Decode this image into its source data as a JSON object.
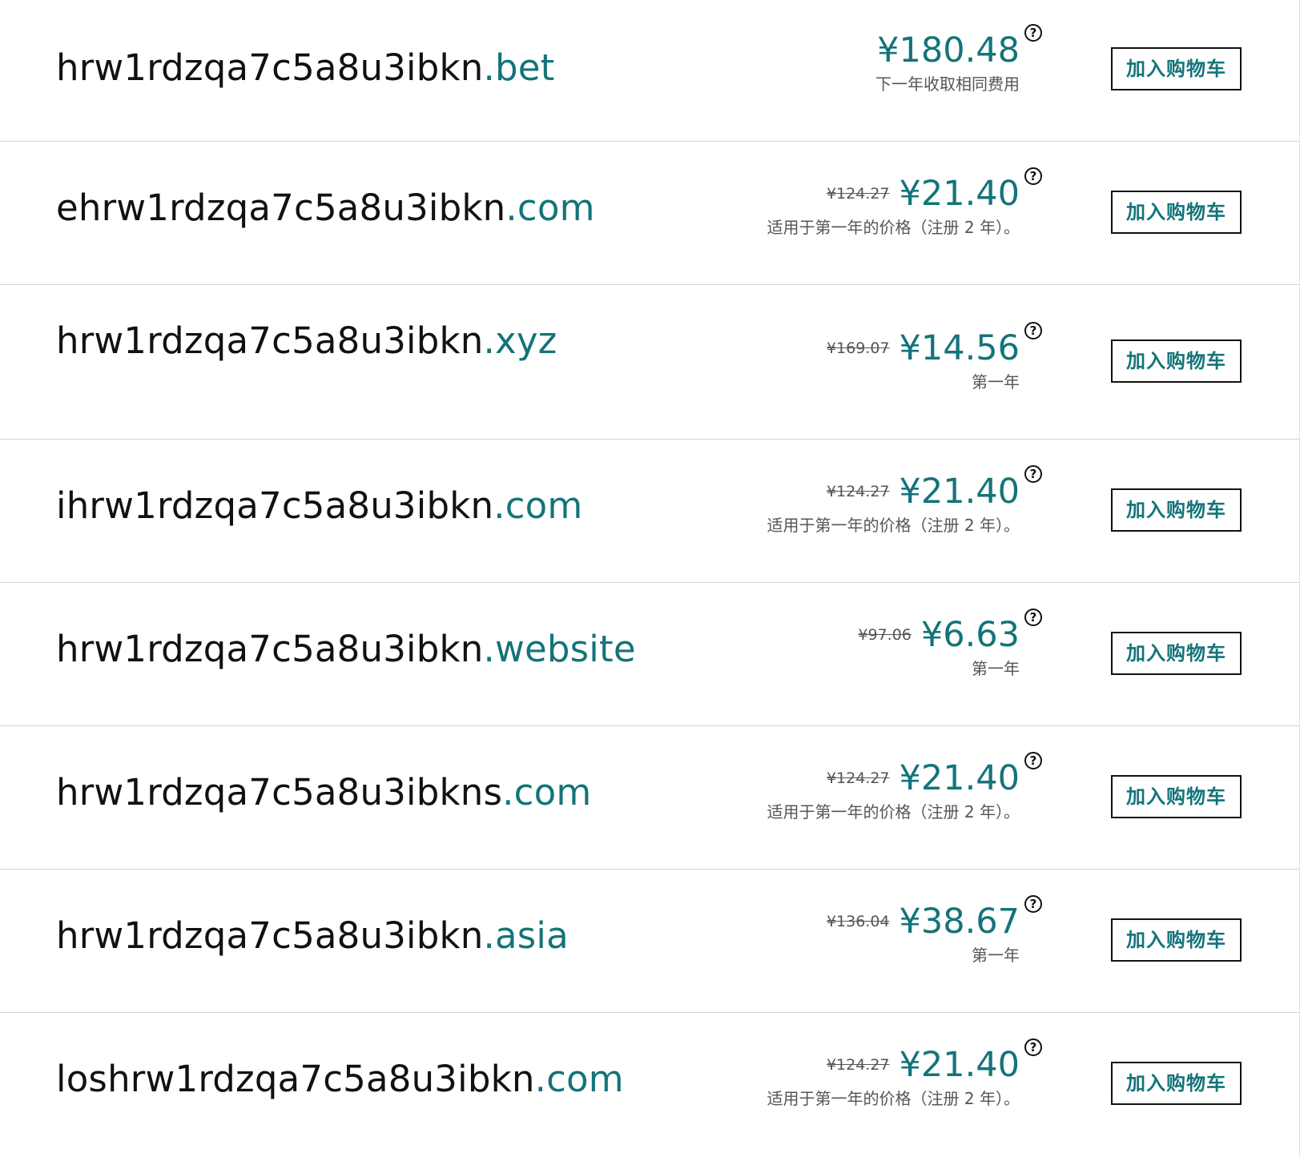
{
  "results": [
    {
      "domain_name": "hrw1rdzqa7c5a8u3ibkn",
      "tld": ".bet",
      "old_price": "",
      "price": "¥180.48",
      "note": "下一年收取相同费用",
      "help_glyph": "?",
      "button_label": "加入购物车"
    },
    {
      "domain_name": "ehrw1rdzqa7c5a8u3ibkn",
      "tld": ".com",
      "old_price": "¥124.27",
      "price": "¥21.40",
      "note": "适用于第一年的价格（注册 2 年）。",
      "help_glyph": "?",
      "button_label": "加入购物车"
    },
    {
      "domain_name": "hrw1rdzqa7c5a8u3ibkn",
      "tld": ".xyz",
      "old_price": "¥169.07",
      "price": "¥14.56",
      "note": "第一年",
      "help_glyph": "?",
      "button_label": "加入购物车"
    },
    {
      "domain_name": "ihrw1rdzqa7c5a8u3ibkn",
      "tld": ".com",
      "old_price": "¥124.27",
      "price": "¥21.40",
      "note": "适用于第一年的价格（注册 2 年）。",
      "help_glyph": "?",
      "button_label": "加入购物车"
    },
    {
      "domain_name": "hrw1rdzqa7c5a8u3ibkn",
      "tld": ".website",
      "old_price": "¥97.06",
      "price": "¥6.63",
      "note": "第一年",
      "help_glyph": "?",
      "button_label": "加入购物车"
    },
    {
      "domain_name": "hrw1rdzqa7c5a8u3ibkns",
      "tld": ".com",
      "old_price": "¥124.27",
      "price": "¥21.40",
      "note": "适用于第一年的价格（注册 2 年）。",
      "help_glyph": "?",
      "button_label": "加入购物车"
    },
    {
      "domain_name": "hrw1rdzqa7c5a8u3ibkn",
      "tld": ".asia",
      "old_price": "¥136.04",
      "price": "¥38.67",
      "note": "第一年",
      "help_glyph": "?",
      "button_label": "加入购物车"
    },
    {
      "domain_name": "loshrw1rdzqa7c5a8u3ibkn",
      "tld": ".com",
      "old_price": "¥124.27",
      "price": "¥21.40",
      "note": "适用于第一年的价格（注册 2 年）。",
      "help_glyph": "?",
      "button_label": "加入购物车"
    }
  ],
  "colors": {
    "accent": "#137479",
    "text": "#111111",
    "muted": "#555555",
    "divider": "#d6d6d6"
  }
}
